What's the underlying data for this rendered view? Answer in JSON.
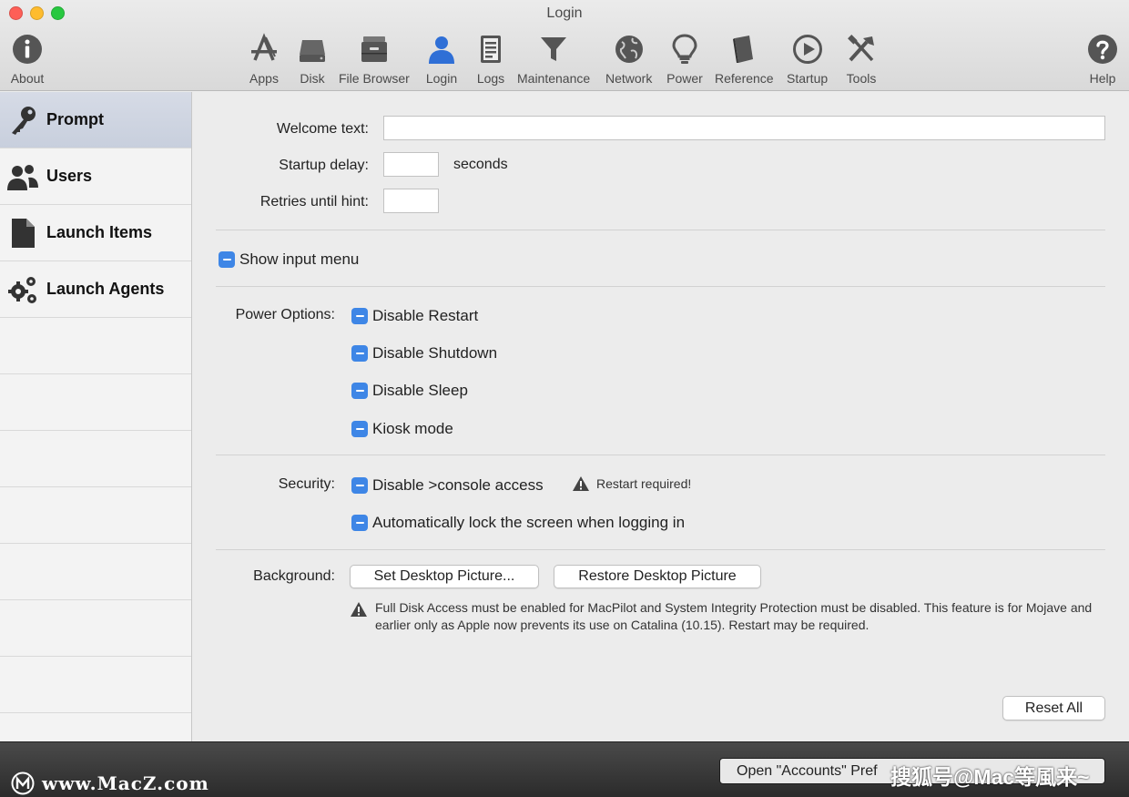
{
  "window": {
    "title": "Login"
  },
  "toolbar": {
    "items": [
      {
        "label": "About",
        "icon": "info-icon"
      },
      {
        "label": "Apps",
        "icon": "apps-icon"
      },
      {
        "label": "Disk",
        "icon": "disk-icon"
      },
      {
        "label": "File Browser",
        "icon": "file-browser-icon"
      },
      {
        "label": "Login",
        "icon": "login-user-icon",
        "selected": true
      },
      {
        "label": "Logs",
        "icon": "logs-icon"
      },
      {
        "label": "Maintenance",
        "icon": "funnel-icon"
      },
      {
        "label": "Network",
        "icon": "globe-icon"
      },
      {
        "label": "Power",
        "icon": "lightbulb-icon"
      },
      {
        "label": "Reference",
        "icon": "book-icon"
      },
      {
        "label": "Startup",
        "icon": "play-icon"
      },
      {
        "label": "Tools",
        "icon": "tools-icon"
      },
      {
        "label": "Help",
        "icon": "help-icon"
      }
    ],
    "accent": "#2f6fd6"
  },
  "sidebar": {
    "items": [
      {
        "label": "Prompt",
        "icon": "key-icon",
        "selected": true
      },
      {
        "label": "Users",
        "icon": "users-icon"
      },
      {
        "label": "Launch Items",
        "icon": "document-icon"
      },
      {
        "label": "Launch Agents",
        "icon": "gears-icon"
      }
    ]
  },
  "form": {
    "welcome_label": "Welcome text:",
    "welcome_value": "",
    "startup_label": "Startup delay:",
    "startup_value": "",
    "startup_unit": "seconds",
    "retries_label": "Retries until hint:",
    "retries_value": "",
    "show_input_menu": "Show input menu",
    "power_label": "Power Options:",
    "power_options": [
      "Disable Restart",
      "Disable Shutdown",
      "Disable Sleep",
      "Kiosk mode"
    ],
    "security_label": "Security:",
    "security_console": "Disable >console access",
    "restart_required": "Restart required!",
    "security_lock": "Automatically lock the screen when logging in",
    "background_label": "Background:",
    "set_desktop": "Set Desktop Picture...",
    "restore_desktop": "Restore Desktop Picture",
    "note": "Full Disk Access must be enabled for MacPilot and System Integrity Protection must be disabled. This feature is for Mojave and earlier only as Apple now prevents its use on Catalina (10.15). Restart may be required.",
    "reset_all": "Reset All",
    "checkbox_color": "#3e86e6"
  },
  "bottom": {
    "open_accounts": "Open \"Accounts\" Pref",
    "watermark_left": "www.MacZ.com",
    "watermark_right": "搜狐号@Mac等風来~"
  }
}
